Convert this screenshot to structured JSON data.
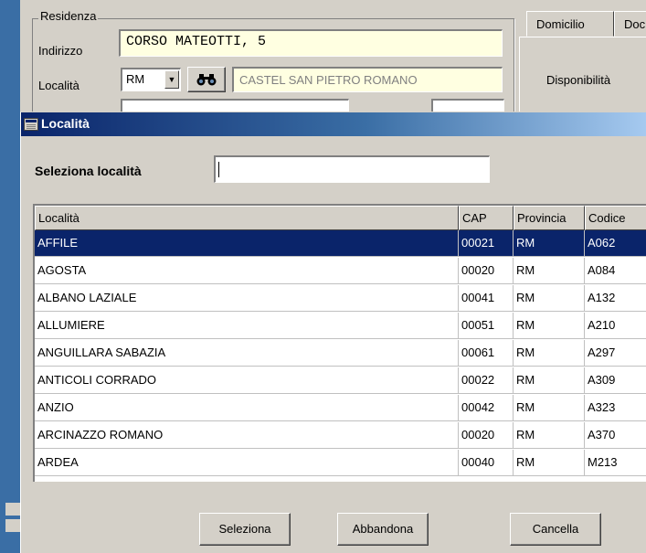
{
  "residenza": {
    "legend": "Residenza",
    "indirizzo_label": "Indirizzo",
    "indirizzo_value": "CORSO MATEOTTI, 5",
    "localita_label": "Località",
    "provincia_value": "RM",
    "localita_value": "CASTEL SAN PIETRO ROMANO"
  },
  "tabs": [
    {
      "label": "Domicilio"
    },
    {
      "label": "Doc"
    }
  ],
  "side_panel": {
    "disponibilita_label": "Disponibilità"
  },
  "dialog": {
    "title": "Località",
    "select_label": "Seleziona località",
    "select_value": "",
    "columns": [
      "Località",
      "CAP",
      "Provincia",
      "Codice"
    ],
    "rows": [
      [
        "AFFILE",
        "00021",
        "RM",
        "A062"
      ],
      [
        "AGOSTA",
        "00020",
        "RM",
        "A084"
      ],
      [
        "ALBANO LAZIALE",
        "00041",
        "RM",
        "A132"
      ],
      [
        "ALLUMIERE",
        "00051",
        "RM",
        "A210"
      ],
      [
        "ANGUILLARA SABAZIA",
        "00061",
        "RM",
        "A297"
      ],
      [
        "ANTICOLI CORRADO",
        "00022",
        "RM",
        "A309"
      ],
      [
        "ANZIO",
        "00042",
        "RM",
        "A323"
      ],
      [
        "ARCINAZZO ROMANO",
        "00020",
        "RM",
        "A370"
      ],
      [
        "ARDEA",
        "00040",
        "RM",
        "M213"
      ]
    ],
    "selected_row": 0,
    "buttons": {
      "seleziona": "Seleziona",
      "abbandona": "Abbandona",
      "cancella": "Cancella"
    }
  },
  "colors": {
    "desktop": "#3a6ea5",
    "window": "#d4d0c8",
    "titlebar_start": "#0a246a",
    "selection": "#0a246a",
    "readonly_field": "#ffffe1"
  }
}
